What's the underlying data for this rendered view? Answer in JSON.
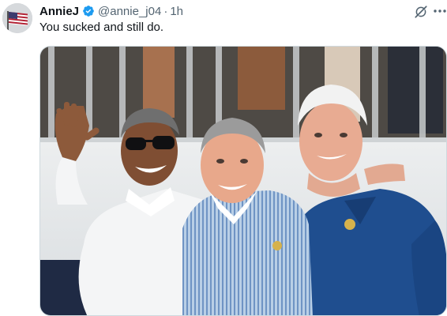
{
  "post": {
    "author_name": "AnnieJ",
    "author_handle": "@annie_j04",
    "separator": "·",
    "timestamp": "1h",
    "text": "You sucked and still do."
  },
  "colors": {
    "verified": "#1d9bf0",
    "secondary_text": "#536471",
    "primary_text": "#0f1419"
  },
  "icons": {
    "verified": "verified-badge-icon",
    "grok": "grok-icon",
    "more": "more-icon"
  }
}
